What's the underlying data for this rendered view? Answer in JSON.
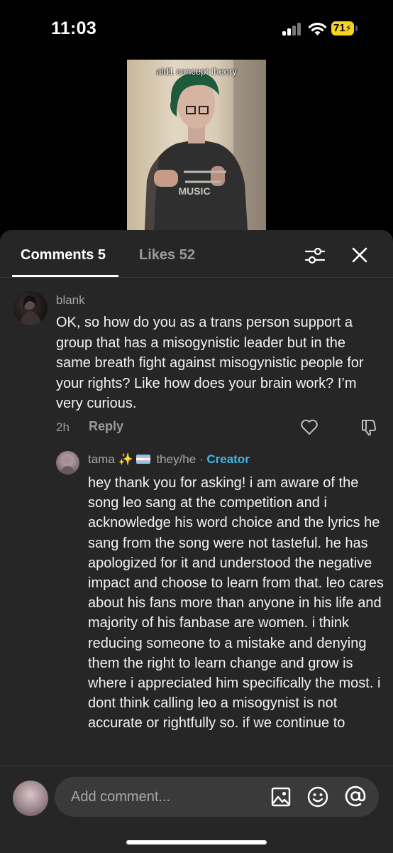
{
  "status_bar": {
    "time": "11:03",
    "battery": "71"
  },
  "video": {
    "caption": "ald1 concept theory"
  },
  "tabs": {
    "comments": "Comments 5",
    "likes": "Likes 52"
  },
  "comments": [
    {
      "username": "blank",
      "text": "OK, so how do you as a trans person support a group that has a misogynistic leader but in the same breath fight against misogynistic people for your rights? Like how does your brain work? I’m very curious.",
      "time": "2h",
      "reply_label": "Reply"
    }
  ],
  "reply": {
    "username": "tama",
    "pronouns": "they/he",
    "separator": "·",
    "badge": "Creator",
    "text": "hey thank you for asking! i am aware of the song leo sang at the competition and i acknowledge his word choice and the lyrics he sang from the song were not tasteful. he has apologized for it and understood the negative impact and choose to learn from that. leo cares about his fans more than anyone in his life and majority of his fanbase are women. i think reducing someone to a mistake and denying them the right to learn change and grow is where i appreciated him specifically the most. i dont think calling leo a misogynist is not accurate or rightfully so. if we continue to"
  },
  "composer": {
    "placeholder": "Add comment..."
  },
  "colors": {
    "accent_creator": "#3fb7e8",
    "sheet_bg": "#262626",
    "battery": "#f7d21e"
  },
  "icons": [
    "signal-icon",
    "wifi-icon",
    "battery-icon",
    "filter-icon",
    "close-icon",
    "heart-icon",
    "dislike-icon",
    "image-icon",
    "emoji-icon",
    "mention-icon"
  ]
}
